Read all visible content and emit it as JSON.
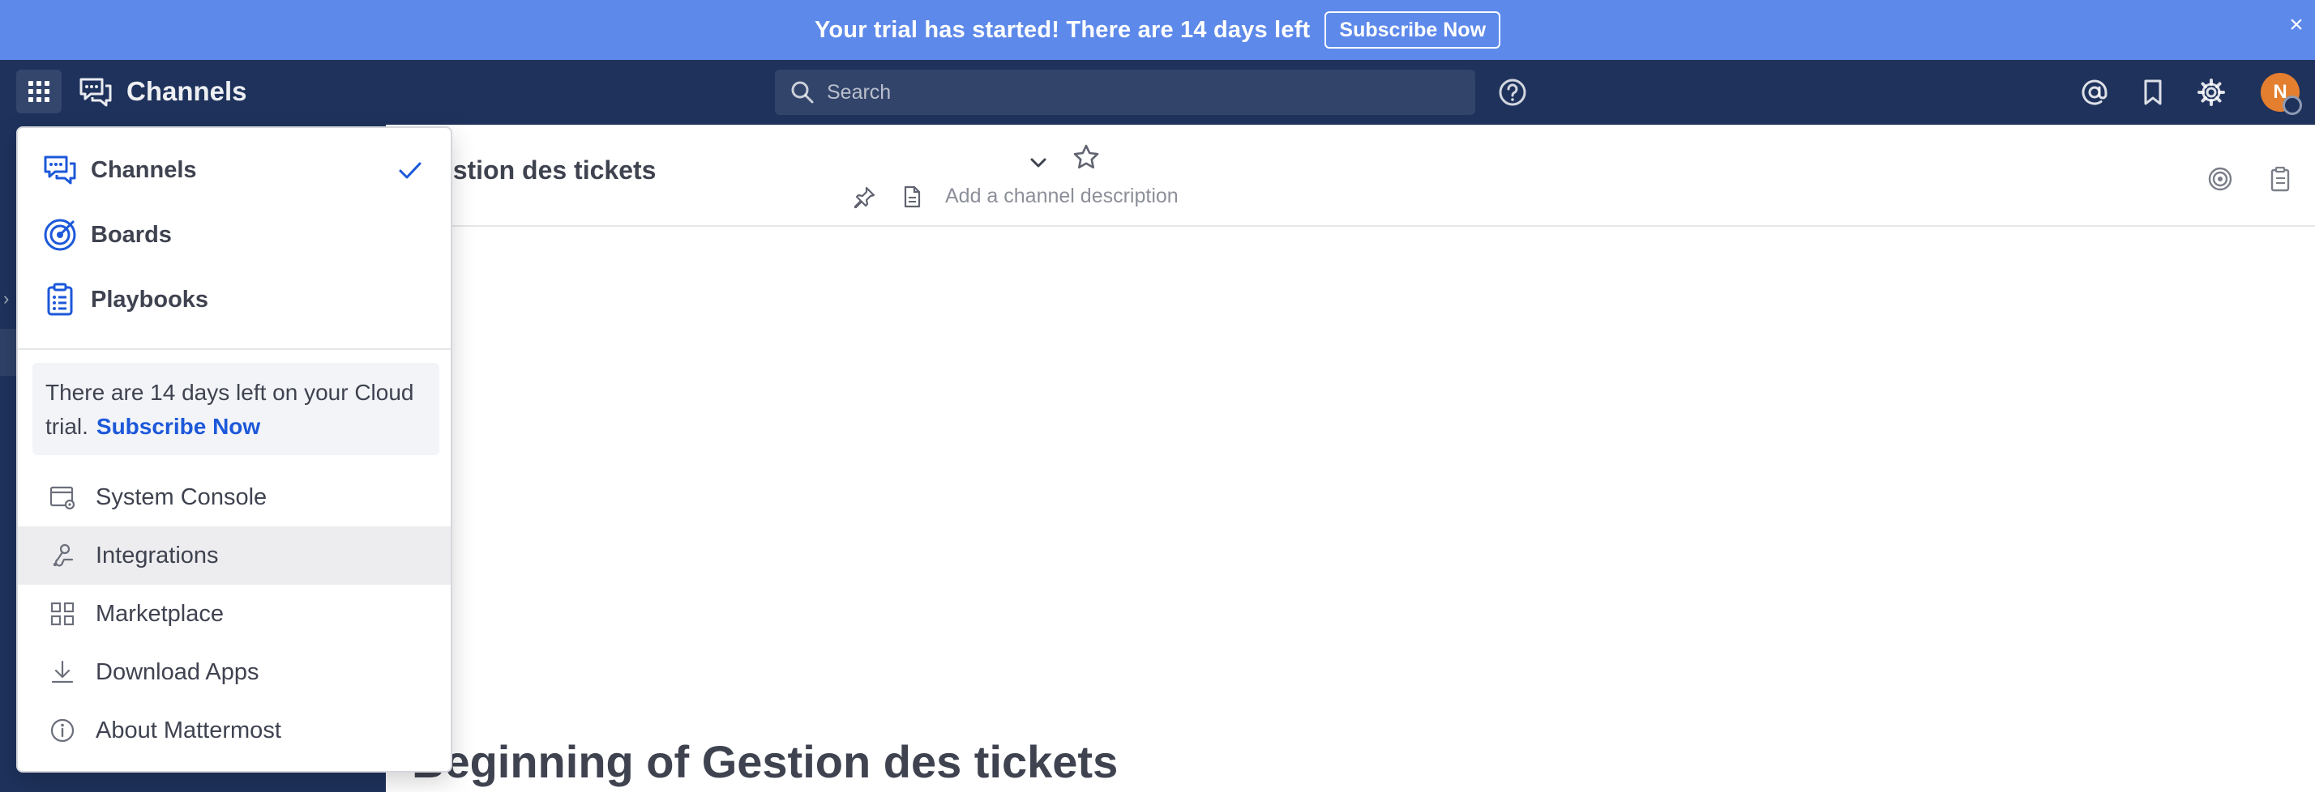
{
  "banner": {
    "message": "Your trial has started! There are 14 days left",
    "button": "Subscribe Now",
    "close": "×",
    "color": "#5d89ea"
  },
  "header": {
    "product_name": "Channels",
    "search_placeholder": "Search",
    "avatar_initial": "N",
    "icons": [
      "grid-icon",
      "channels-icon",
      "search-icon",
      "help-icon",
      "at-mention-icon",
      "bookmark-icon",
      "gear-icon"
    ],
    "bg_color": "#1e325c"
  },
  "sidebar": {
    "chevron": "›"
  },
  "channel": {
    "title": "Gestion des tickets",
    "description_placeholder": "Add a channel description",
    "intro_title": "Beginning of Gestion des tickets"
  },
  "product_menu": {
    "products": [
      {
        "label": "Channels",
        "icon": "channels-icon",
        "selected": true
      },
      {
        "label": "Boards",
        "icon": "boards-icon",
        "selected": false
      },
      {
        "label": "Playbooks",
        "icon": "playbooks-icon",
        "selected": false
      }
    ],
    "trial_text": "There are 14 days left on your Cloud trial.",
    "trial_link": "Subscribe Now",
    "items": [
      {
        "label": "System Console",
        "icon": "system-console-icon"
      },
      {
        "label": "Integrations",
        "icon": "integrations-icon",
        "hovered": true
      },
      {
        "label": "Marketplace",
        "icon": "marketplace-icon"
      },
      {
        "label": "Download Apps",
        "icon": "download-icon"
      },
      {
        "label": "About Mattermost",
        "icon": "info-icon"
      }
    ],
    "accent_color": "#1c58d9"
  }
}
